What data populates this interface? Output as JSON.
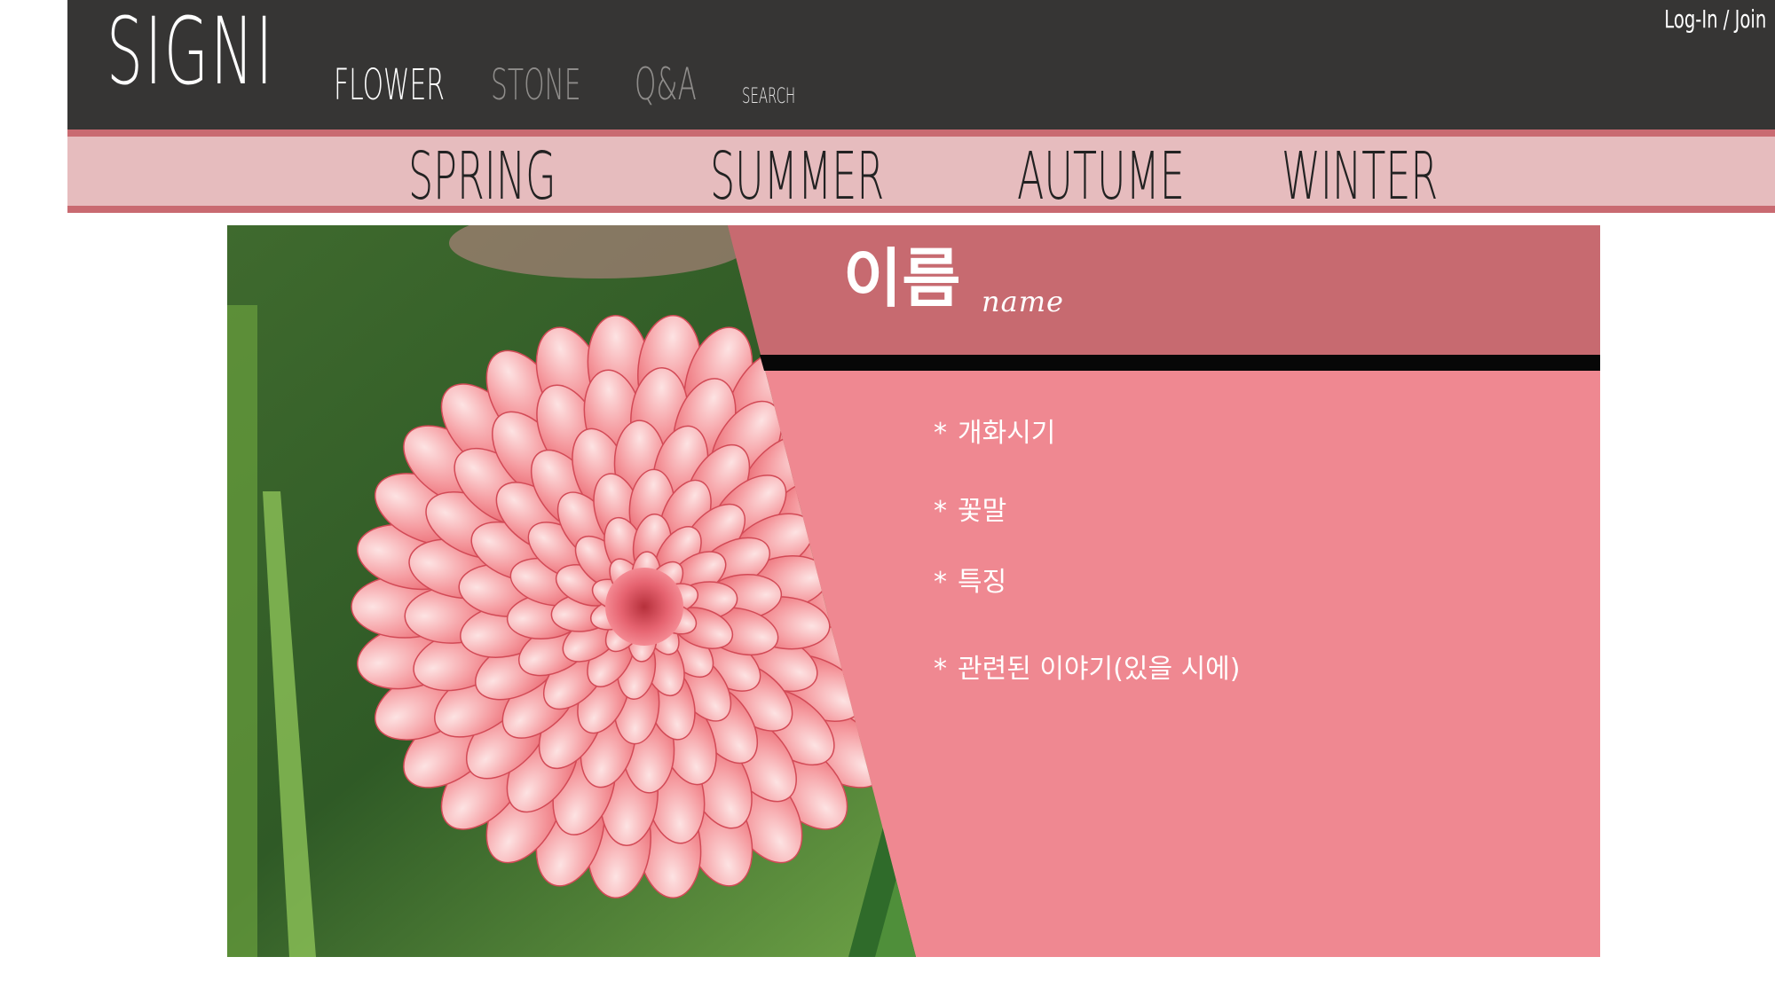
{
  "header": {
    "logo": "SIGNI",
    "nav": {
      "flower": "FLOWER",
      "stone": "STONE",
      "qa": "Q&A",
      "search": "SEARCH"
    },
    "auth": "Log-In / Join"
  },
  "seasons": {
    "spring": "SPRING",
    "summer": "SUMMER",
    "autume": "AUTUME",
    "winter": "WINTER"
  },
  "detail": {
    "name_ko": "이름",
    "name_en": "name",
    "bullet": "*",
    "fields": {
      "bloom": "개화시기",
      "meaning": "꽃말",
      "feature": "특징",
      "story": "관련된 이야기(있을 시에)"
    },
    "image_icon": "dahlia-photo"
  },
  "colors": {
    "header_bg": "#363534",
    "season_bg": "#e6bcbe",
    "season_border": "#c96a71",
    "name_block": "#c76a70",
    "panel_bg": "#ef8891",
    "nav_inactive": "#8f8d8b"
  }
}
